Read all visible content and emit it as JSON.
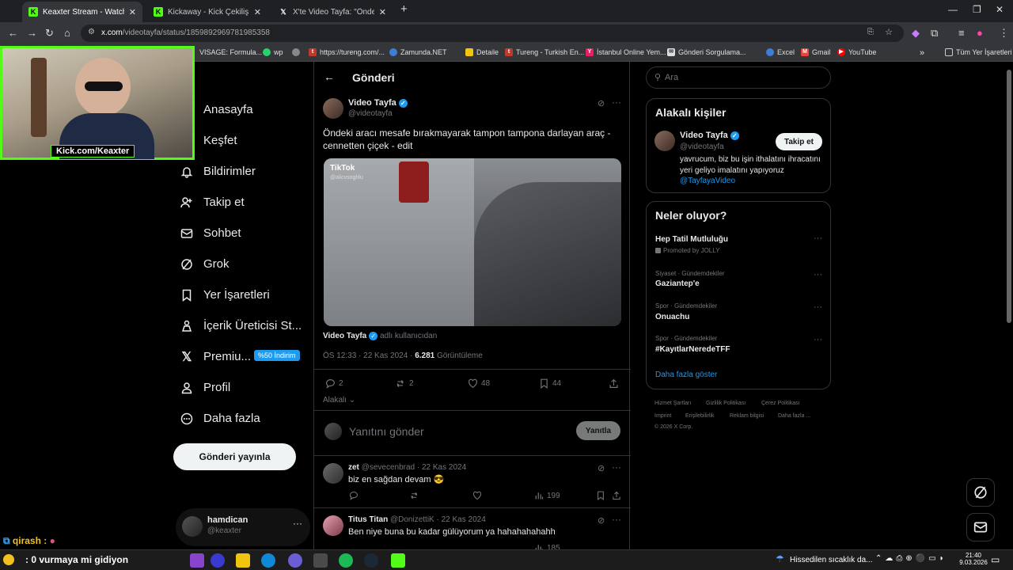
{
  "browser": {
    "tabs": [
      {
        "label": "Keaxter Stream - Watch Live on",
        "icon": "kick-icon",
        "active": true
      },
      {
        "label": "Kickaway - Kick Çekiliş Aracı",
        "icon": "kick-icon",
        "active": false
      },
      {
        "label": "X'te Video Tayfa: \"Öndeki a",
        "icon": "x-icon",
        "active": false
      }
    ],
    "url_host": "x.com",
    "url_path": "/videotayfa/status/1859892969781985358",
    "bookmarks": [
      {
        "label": "VISAGE: Formula...",
        "icon": "page-icon"
      },
      {
        "label": "wp",
        "icon": "whatsapp-icon"
      },
      {
        "label": "",
        "icon": "globe-icon"
      },
      {
        "label": "https://tureng.com/...",
        "icon": "tureng-icon"
      },
      {
        "label": "Zamunda.NET",
        "icon": "zamunda-icon"
      },
      {
        "label": "Detaile",
        "icon": "folder-icon"
      },
      {
        "label": "Tureng - Turkish En...",
        "icon": "tureng-icon"
      },
      {
        "label": "İstanbul Online Yem...",
        "icon": "yemek-icon"
      },
      {
        "label": "Gönderi Sorgulama...",
        "icon": "envelope-icon"
      },
      {
        "label": "Excel",
        "icon": "excel-icon"
      },
      {
        "label": "Gmail",
        "icon": "gmail-icon"
      },
      {
        "label": "YouTube",
        "icon": "youtube-icon"
      }
    ],
    "all_bookmarks": "Tüm Yer İşaretleri"
  },
  "nav": {
    "items": [
      {
        "label": "Anasayfa",
        "icon": "home-icon"
      },
      {
        "label": "Keşfet",
        "icon": "search-icon"
      },
      {
        "label": "Bildirimler",
        "icon": "bell-icon"
      },
      {
        "label": "Takip et",
        "icon": "follow-icon"
      },
      {
        "label": "Sohbet",
        "icon": "mail-icon"
      },
      {
        "label": "Grok",
        "icon": "grok-icon"
      },
      {
        "label": "Yer İşaretleri",
        "icon": "bookmark-icon"
      },
      {
        "label": "İçerik Üreticisi St...",
        "icon": "creator-icon"
      },
      {
        "label": "Premiu...",
        "icon": "x-logo-icon"
      },
      {
        "label": "Profil",
        "icon": "person-icon"
      },
      {
        "label": "Daha fazla",
        "icon": "more-circle-icon"
      }
    ],
    "premium_badge": "%50 İndirim",
    "post_button": "Gönderi yayınla",
    "profile_name": "hamdican",
    "profile_handle": "@keaxter"
  },
  "header": {
    "title": "Gönderi"
  },
  "post": {
    "author": "Video Tayfa",
    "handle": "@videotayfa",
    "text": "Öndeki aracı mesafe bırakmayarak tampon tampona darlayan araç - cennetten çiçek - edit",
    "media_watermark": "TikTok",
    "media_user": "@alicvsoghlu",
    "attribution_name": "Video Tayfa",
    "attribution_suffix": "adlı kullanıcıdan",
    "time": "ÖS 12:33 · 22 Kas 2024 ·",
    "views_count": "6.281",
    "views_label": "Görüntüleme",
    "replies": "2",
    "reposts": "2",
    "likes": "48",
    "bookmarks": "44",
    "sort_label": "Alakalı"
  },
  "reply_box": {
    "placeholder": "Yanıtını gönder",
    "button": "Yanıtla"
  },
  "replies": [
    {
      "name": "zet",
      "handle": "@sevecenbrad · 22 Kas 2024",
      "text": "biz en sağdan devam 😎",
      "views": "199"
    },
    {
      "name": "Titus Titan",
      "handle": "@DonizettiK · 22 Kas 2024",
      "text": "Ben niye buna bu kadar gülüyorum ya hahahahahahh",
      "views": "185"
    }
  ],
  "right": {
    "search_placeholder": "Ara",
    "relevant_title": "Alakalı kişiler",
    "relevant_name": "Video Tayfa",
    "relevant_handle": "@videotayfa",
    "follow_button": "Takip et",
    "relevant_bio": "yavrucum, biz bu işin ithalatını ihracatını yeri geliyo imalatını yapıyoruz",
    "relevant_bio_link": "@TayfayaVideo",
    "trends_title": "Neler oluyor?",
    "trends": [
      {
        "meta": "",
        "name": "Hep Tatil Mutluluğu",
        "promo": "Promoted by JOLLY"
      },
      {
        "meta": "Siyaset · Gündemdekiler",
        "name": "Gaziantep'e",
        "promo": ""
      },
      {
        "meta": "Spor · Gündemdekiler",
        "name": "Onuachu",
        "promo": ""
      },
      {
        "meta": "Spor · Gündemdekiler",
        "name": "#KayıtlarNeredeTFF",
        "promo": ""
      }
    ],
    "show_more": "Daha fazla göster",
    "footer": [
      "Hizmet Şartları",
      "Gizlilik Politikası",
      "Çerez Politikası",
      "Imprint",
      "Erişilebilirlik",
      "Reklam bilgisi",
      "Daha fazla ...",
      "© 2026 X Corp."
    ]
  },
  "stream": {
    "kick_tag": "Kick.com/Keaxter",
    "chat_user": "qirash :",
    "chat_line": ": 0 vurmaya mi gidiyon"
  },
  "taskbar": {
    "weather": "Hissedilen sıcaklık da...",
    "time": "21:40",
    "date": "9.03.2026"
  },
  "colors": {
    "accent": "#1d9bf0",
    "kick": "#53fc18"
  }
}
